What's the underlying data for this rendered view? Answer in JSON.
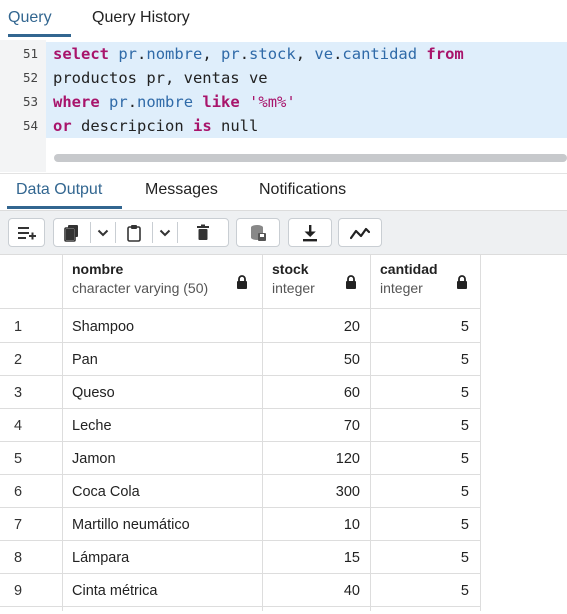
{
  "query_tabs": {
    "query": "Query",
    "history": "Query History"
  },
  "editor": {
    "lines": [
      {
        "num": "51",
        "tokens": [
          [
            "kw",
            "select"
          ],
          [
            "plain",
            " "
          ],
          [
            "id",
            "pr"
          ],
          [
            "plain",
            "."
          ],
          [
            "id",
            "nombre"
          ],
          [
            "plain",
            ", "
          ],
          [
            "id",
            "pr"
          ],
          [
            "plain",
            "."
          ],
          [
            "id",
            "stock"
          ],
          [
            "plain",
            ", "
          ],
          [
            "id",
            "ve"
          ],
          [
            "plain",
            "."
          ],
          [
            "id",
            "cantidad"
          ],
          [
            "plain",
            " "
          ],
          [
            "kw",
            "from"
          ]
        ]
      },
      {
        "num": "52",
        "tokens": [
          [
            "plain",
            "productos pr, ventas ve"
          ]
        ]
      },
      {
        "num": "53",
        "tokens": [
          [
            "kw",
            "where"
          ],
          [
            "plain",
            " "
          ],
          [
            "id",
            "pr"
          ],
          [
            "plain",
            "."
          ],
          [
            "id",
            "nombre"
          ],
          [
            "plain",
            " "
          ],
          [
            "kw",
            "like"
          ],
          [
            "plain",
            " "
          ],
          [
            "str",
            "'%m%'"
          ]
        ]
      },
      {
        "num": "54",
        "tokens": [
          [
            "kw",
            "or"
          ],
          [
            "plain",
            " descripcion "
          ],
          [
            "kw",
            "is"
          ],
          [
            "plain",
            " null"
          ]
        ]
      }
    ]
  },
  "output_tabs": {
    "data_output": "Data Output",
    "messages": "Messages",
    "notifications": "Notifications"
  },
  "toolbar": {
    "icons": [
      "add-row-icon",
      "copy-icon",
      "chevron-down-icon",
      "paste-icon",
      "chevron-down-icon",
      "delete-icon",
      "save-data-icon",
      "download-icon",
      "graph-icon"
    ]
  },
  "grid": {
    "columns": [
      {
        "name": "nombre",
        "type": "character varying (50)"
      },
      {
        "name": "stock",
        "type": "integer"
      },
      {
        "name": "cantidad",
        "type": "integer"
      }
    ],
    "rows": [
      {
        "n": "1",
        "nombre": "Shampoo",
        "stock": "20",
        "cantidad": "5"
      },
      {
        "n": "2",
        "nombre": "Pan",
        "stock": "50",
        "cantidad": "5"
      },
      {
        "n": "3",
        "nombre": "Queso",
        "stock": "60",
        "cantidad": "5"
      },
      {
        "n": "4",
        "nombre": "Leche",
        "stock": "70",
        "cantidad": "5"
      },
      {
        "n": "5",
        "nombre": "Jamon",
        "stock": "120",
        "cantidad": "5"
      },
      {
        "n": "6",
        "nombre": "Coca Cola",
        "stock": "300",
        "cantidad": "5"
      },
      {
        "n": "7",
        "nombre": "Martillo neumático",
        "stock": "10",
        "cantidad": "5"
      },
      {
        "n": "8",
        "nombre": "Lámpara",
        "stock": "15",
        "cantidad": "5"
      },
      {
        "n": "9",
        "nombre": "Cinta métrica",
        "stock": "40",
        "cantidad": "5"
      }
    ]
  },
  "colors": {
    "accent": "#326690",
    "keyword": "#a8146b",
    "identifier": "#2f6aa8",
    "line_highlight": "#dfeefb"
  }
}
